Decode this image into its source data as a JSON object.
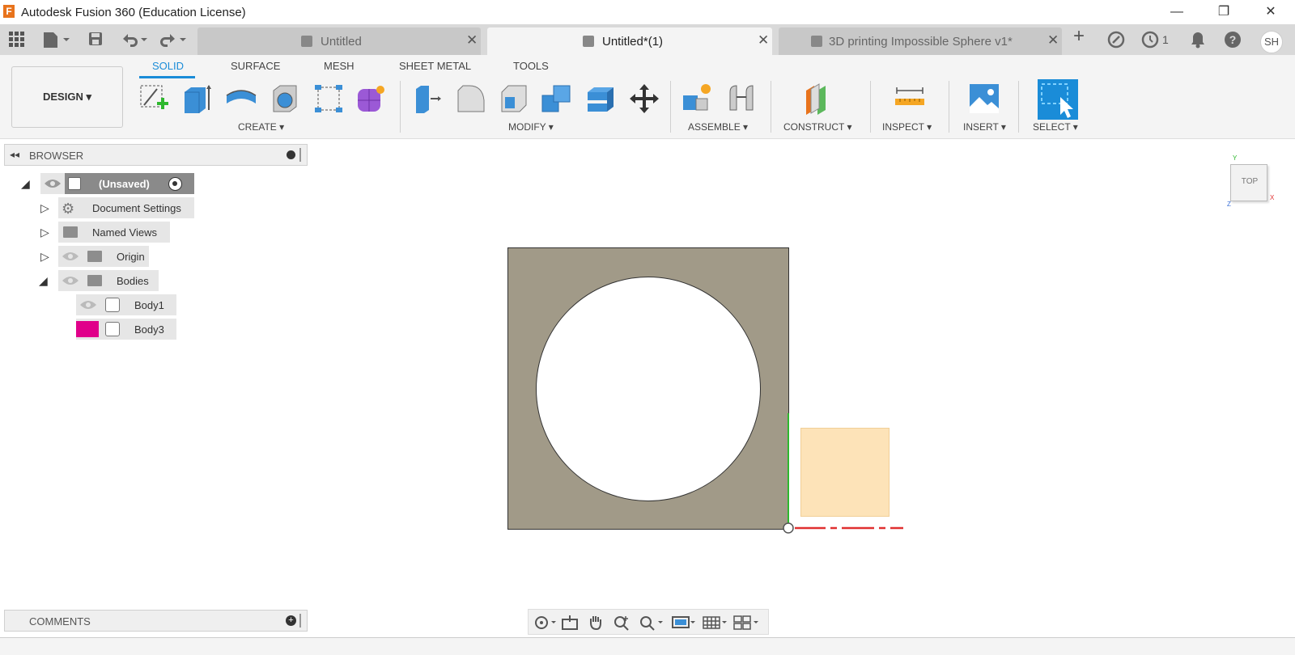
{
  "window": {
    "title": "Autodesk Fusion 360 (Education License)",
    "logo_letter": "F",
    "minimize": "—",
    "restore": "❐",
    "close": "✕"
  },
  "tabs": [
    {
      "label": "Untitled",
      "active": false
    },
    {
      "label": "Untitled*(1)",
      "active": true
    },
    {
      "label": "3D printing Impossible Sphere v1*",
      "active": false
    }
  ],
  "tabbar": {
    "add": "+",
    "jobs_count": "1",
    "user_initials": "SH"
  },
  "toolbar": {
    "workspace": "DESIGN",
    "tabs": [
      "SOLID",
      "SURFACE",
      "MESH",
      "SHEET METAL",
      "TOOLS"
    ],
    "groups": [
      "CREATE",
      "MODIFY",
      "ASSEMBLE",
      "CONSTRUCT",
      "INSPECT",
      "INSERT",
      "SELECT"
    ]
  },
  "browser": {
    "title": "BROWSER",
    "root": "(Unsaved)",
    "items": [
      "Document Settings",
      "Named Views",
      "Origin",
      "Bodies"
    ],
    "bodies": [
      "Body1",
      "Body3"
    ],
    "body3_color": "#e0008a"
  },
  "viewcube": {
    "face": "TOP",
    "axis_y": "Y",
    "axis_x": "X",
    "axis_z": "Z"
  },
  "comments": {
    "title": "COMMENTS"
  },
  "colors": {
    "accent": "#1a8cd8",
    "body_fill": "#a19a88",
    "ghost_fill": "#fde3b8",
    "x_axis": "#e03030",
    "y_axis": "#2eb82e"
  }
}
